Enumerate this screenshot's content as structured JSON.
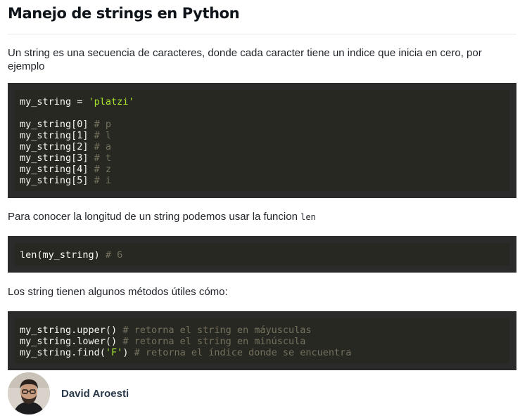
{
  "article": {
    "title": "Manejo de strings en Python",
    "intro": "Un string es una secuencia de caracteres, donde cada caracter tiene un indice que inicia en cero, por ejemplo",
    "length_text": "Para conocer la longitud de un string podemos usar la funcion",
    "length_func": "len",
    "methods_text": "Los string tienen algunos métodos útiles cómo:"
  },
  "code_blocks": [
    {
      "lines": [
        [
          {
            "t": "my_string = "
          },
          {
            "t": "'platzi'",
            "c": "str"
          }
        ],
        [],
        [
          {
            "t": "my_string[0] "
          },
          {
            "t": "# p",
            "c": "cmt"
          }
        ],
        [
          {
            "t": "my_string[1] "
          },
          {
            "t": "# l",
            "c": "cmt"
          }
        ],
        [
          {
            "t": "my_string[2] "
          },
          {
            "t": "# a",
            "c": "cmt"
          }
        ],
        [
          {
            "t": "my_string[3] "
          },
          {
            "t": "# t",
            "c": "cmt"
          }
        ],
        [
          {
            "t": "my_string[4] "
          },
          {
            "t": "# z",
            "c": "cmt"
          }
        ],
        [
          {
            "t": "my_string[5] "
          },
          {
            "t": "# i",
            "c": "cmt"
          }
        ]
      ]
    },
    {
      "lines": [
        [
          {
            "t": "len(my_string) "
          },
          {
            "t": "# 6",
            "c": "cmt"
          }
        ]
      ]
    },
    {
      "lines": [
        [
          {
            "t": "my_string.upper() "
          },
          {
            "t": "# retorna el string en máyusculas",
            "c": "cmt"
          }
        ],
        [
          {
            "t": "my_string.lower() "
          },
          {
            "t": "# retorna el string en minúscula",
            "c": "cmt"
          }
        ],
        [
          {
            "t": "my_string.find("
          },
          {
            "t": "'F'",
            "c": "str"
          },
          {
            "t": ") "
          },
          {
            "t": "# retorna el índice donde se encuentra",
            "c": "cmt"
          }
        ]
      ]
    }
  ],
  "author": {
    "name": "David Aroesti",
    "avatar_icon": "user-avatar-photo"
  },
  "colors": {
    "code_background": "#272822",
    "code_border": "#2b2b2b",
    "string": "#a6e22e",
    "comment": "#75715e"
  }
}
